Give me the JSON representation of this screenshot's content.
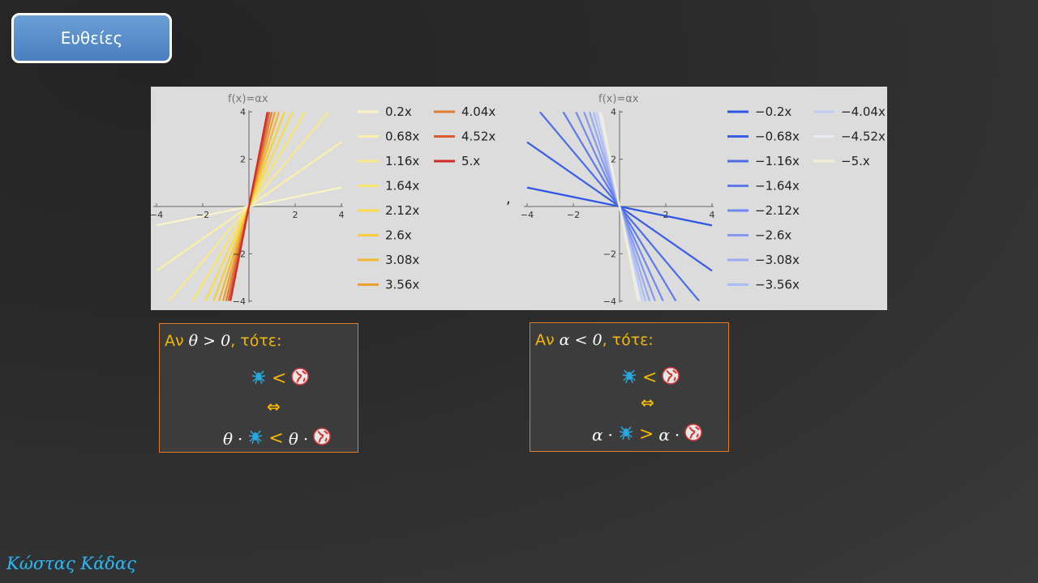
{
  "slide": {
    "title": "Ευθείες",
    "author": "Κώστας Κάδας"
  },
  "left_plot": {
    "function_label": "f(x)=αx",
    "x_ticks": [
      "−4",
      "−2",
      "2",
      "4"
    ],
    "y_ticks": [
      "4",
      "2",
      "−2",
      "−4"
    ],
    "legend": [
      "0.2x",
      "0.68x",
      "1.16x",
      "1.64x",
      "2.12x",
      "2.6x",
      "3.08x",
      "3.56x",
      "4.04x",
      "4.52x",
      "5.x"
    ]
  },
  "separator": ",",
  "right_plot": {
    "function_label": "f(x)=αx",
    "x_ticks": [
      "−4",
      "−2",
      "2",
      "4"
    ],
    "y_ticks": [
      "4",
      "2",
      "−2",
      "−4"
    ],
    "legend": [
      "−0.2x",
      "−0.68x",
      "−1.16x",
      "−1.64x",
      "−2.12x",
      "−2.6x",
      "−3.08x",
      "−3.56x",
      "−4.04x",
      "−4.52x",
      "−5.x"
    ]
  },
  "chart_data": [
    {
      "type": "line",
      "title": "f(x)=αx",
      "xlim": [
        -4,
        4
      ],
      "ylim": [
        -4,
        4
      ],
      "slopes": [
        0.2,
        0.68,
        1.16,
        1.64,
        2.12,
        2.6,
        3.08,
        3.56,
        4.04,
        4.52,
        5.0
      ],
      "colors": [
        "#fbf3c8",
        "#fbf0a8",
        "#fae98a",
        "#f9e46a",
        "#f8dc4a",
        "#f6cf3a",
        "#f2b730",
        "#ec9f30",
        "#e07d30",
        "#d95a30",
        "#d42a2a"
      ]
    },
    {
      "type": "line",
      "title": "f(x)=αx",
      "xlim": [
        -4,
        4
      ],
      "ylim": [
        -4,
        4
      ],
      "slopes": [
        -0.2,
        -0.68,
        -1.16,
        -1.64,
        -2.12,
        -2.6,
        -3.08,
        -3.56,
        -4.04,
        -4.52,
        -5.0
      ],
      "colors": [
        "#2f55e6",
        "#3a5ee8",
        "#4c6bea",
        "#5e79ec",
        "#7188ee",
        "#8598f0",
        "#99a9f2",
        "#adbbf4",
        "#c2cdf6",
        "#e6e9f6",
        "#f3f0d4"
      ]
    }
  ],
  "rule_left": {
    "prefix": "Αν ",
    "condition": "θ > 0",
    "suffix": ", τότε:",
    "iff": "⇔",
    "coef": "θ",
    "dot": "·",
    "rel_top": "<",
    "rel_bottom": "<"
  },
  "rule_right": {
    "prefix": "Αν ",
    "condition": "α < 0",
    "suffix": ", τότε:",
    "iff": "⇔",
    "coef": "α",
    "dot": "·",
    "rel_top": "<",
    "rel_bottom": ">"
  },
  "icons": {
    "spider": "spider-icon",
    "globe": "globe-icon"
  }
}
